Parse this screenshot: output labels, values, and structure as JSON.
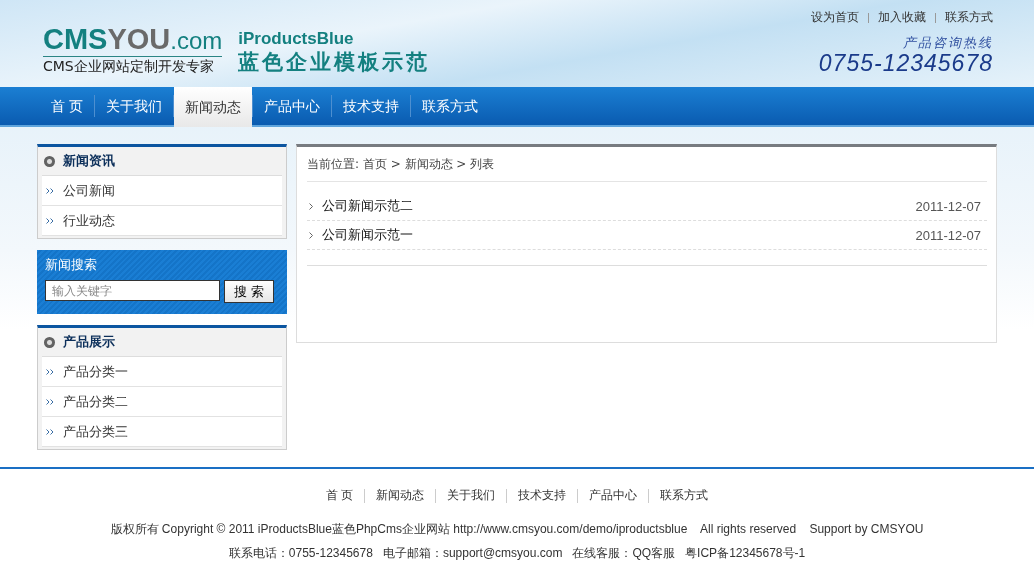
{
  "header": {
    "logo": {
      "part_a": "CMS",
      "part_b": "YOU",
      "suffix": ".com",
      "tagline": "CMS企业网站定制开发专家"
    },
    "site_title": {
      "name": "iProductsBlue",
      "subtitle": "蓝色企业模板示范"
    },
    "top_links": [
      "设为首页",
      "加入收藏",
      "联系方式"
    ],
    "hotline": {
      "label": "产品咨询热线",
      "number": "0755-12345678"
    }
  },
  "nav": [
    {
      "label": "首 页",
      "selected": false
    },
    {
      "label": "关于我们",
      "selected": false
    },
    {
      "label": "新闻动态",
      "selected": true
    },
    {
      "label": "产品中心",
      "selected": false
    },
    {
      "label": "技术支持",
      "selected": false
    },
    {
      "label": "联系方式",
      "selected": false
    }
  ],
  "sidebar": [
    {
      "kind": "list",
      "title": "新闻资讯",
      "items": [
        "公司新闻",
        "行业动态"
      ]
    },
    {
      "kind": "search",
      "title": "新闻搜索",
      "placeholder": "输入关键字",
      "button": "搜 索"
    },
    {
      "kind": "list",
      "title": "产品展示",
      "items": [
        "产品分类一",
        "产品分类二",
        "产品分类三"
      ]
    }
  ],
  "main": {
    "breadcrumb": "当前位置: 首页 > 新闻动态 > 列表",
    "articles": [
      {
        "title": "公司新闻示范二",
        "date": "2011-12-07"
      },
      {
        "title": "公司新闻示范一",
        "date": "2011-12-07"
      }
    ]
  },
  "footer": {
    "links": [
      "首 页",
      "新闻动态",
      "关于我们",
      "技术支持",
      "产品中心",
      "联系方式"
    ],
    "copyright": "版权所有 Copyright © 2011 iProductsBlue蓝色PhpCms企业网站 http://www.cmsyou.com/demo/iproductsblue    All rights reserved    Support by CMSYOU",
    "contact": "联系电话：0755-12345678   电子邮箱：support@cmsyou.com   在线客服：QQ客服   粤ICP备12345678号-1"
  }
}
